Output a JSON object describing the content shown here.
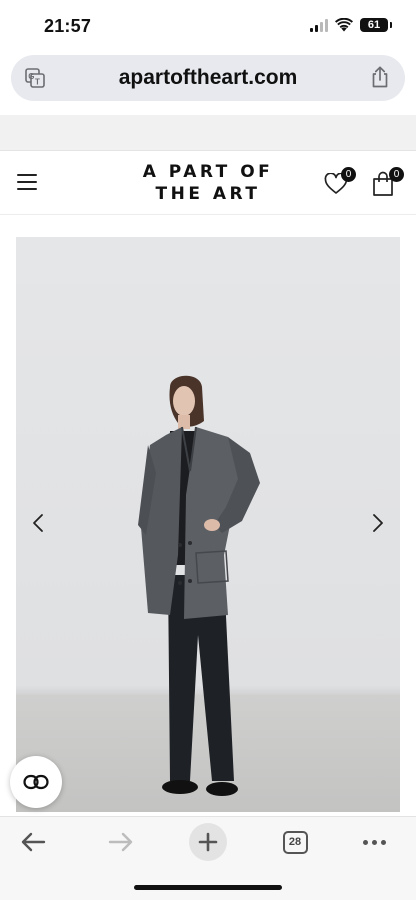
{
  "status_bar": {
    "time": "21:57",
    "battery_level": "61",
    "signal_bars_active": 2,
    "signal_bars_total": 4,
    "wifi_icon": "wifi-icon"
  },
  "browser": {
    "url": "apartoftheart.com",
    "translate_icon": "translate-icon",
    "share_icon": "share-icon",
    "toolbar": {
      "back_icon": "arrow-left-icon",
      "forward_icon": "arrow-right-icon",
      "new_tab_icon": "plus-icon",
      "tab_count": "28",
      "more_icon": "ellipsis-icon"
    }
  },
  "site_header": {
    "menu_icon": "hamburger-menu-icon",
    "logo_line1": "A PART OF",
    "logo_line2": "THE ART",
    "wishlist_count": "0",
    "cart_count": "0"
  },
  "product_gallery": {
    "prev_icon": "chevron-left-icon",
    "next_icon": "chevron-right-icon",
    "image_description_icon": "product-photo"
  },
  "chat_widget": {
    "icon": "chat-link-icon"
  },
  "colors": {
    "url_bar_bg": "#e7e9ee",
    "toolbar_bg": "#f7f7f7",
    "badge_bg": "#111111",
    "photo_wall": "#e2e3e5",
    "photo_floor": "#c8c8c7"
  }
}
